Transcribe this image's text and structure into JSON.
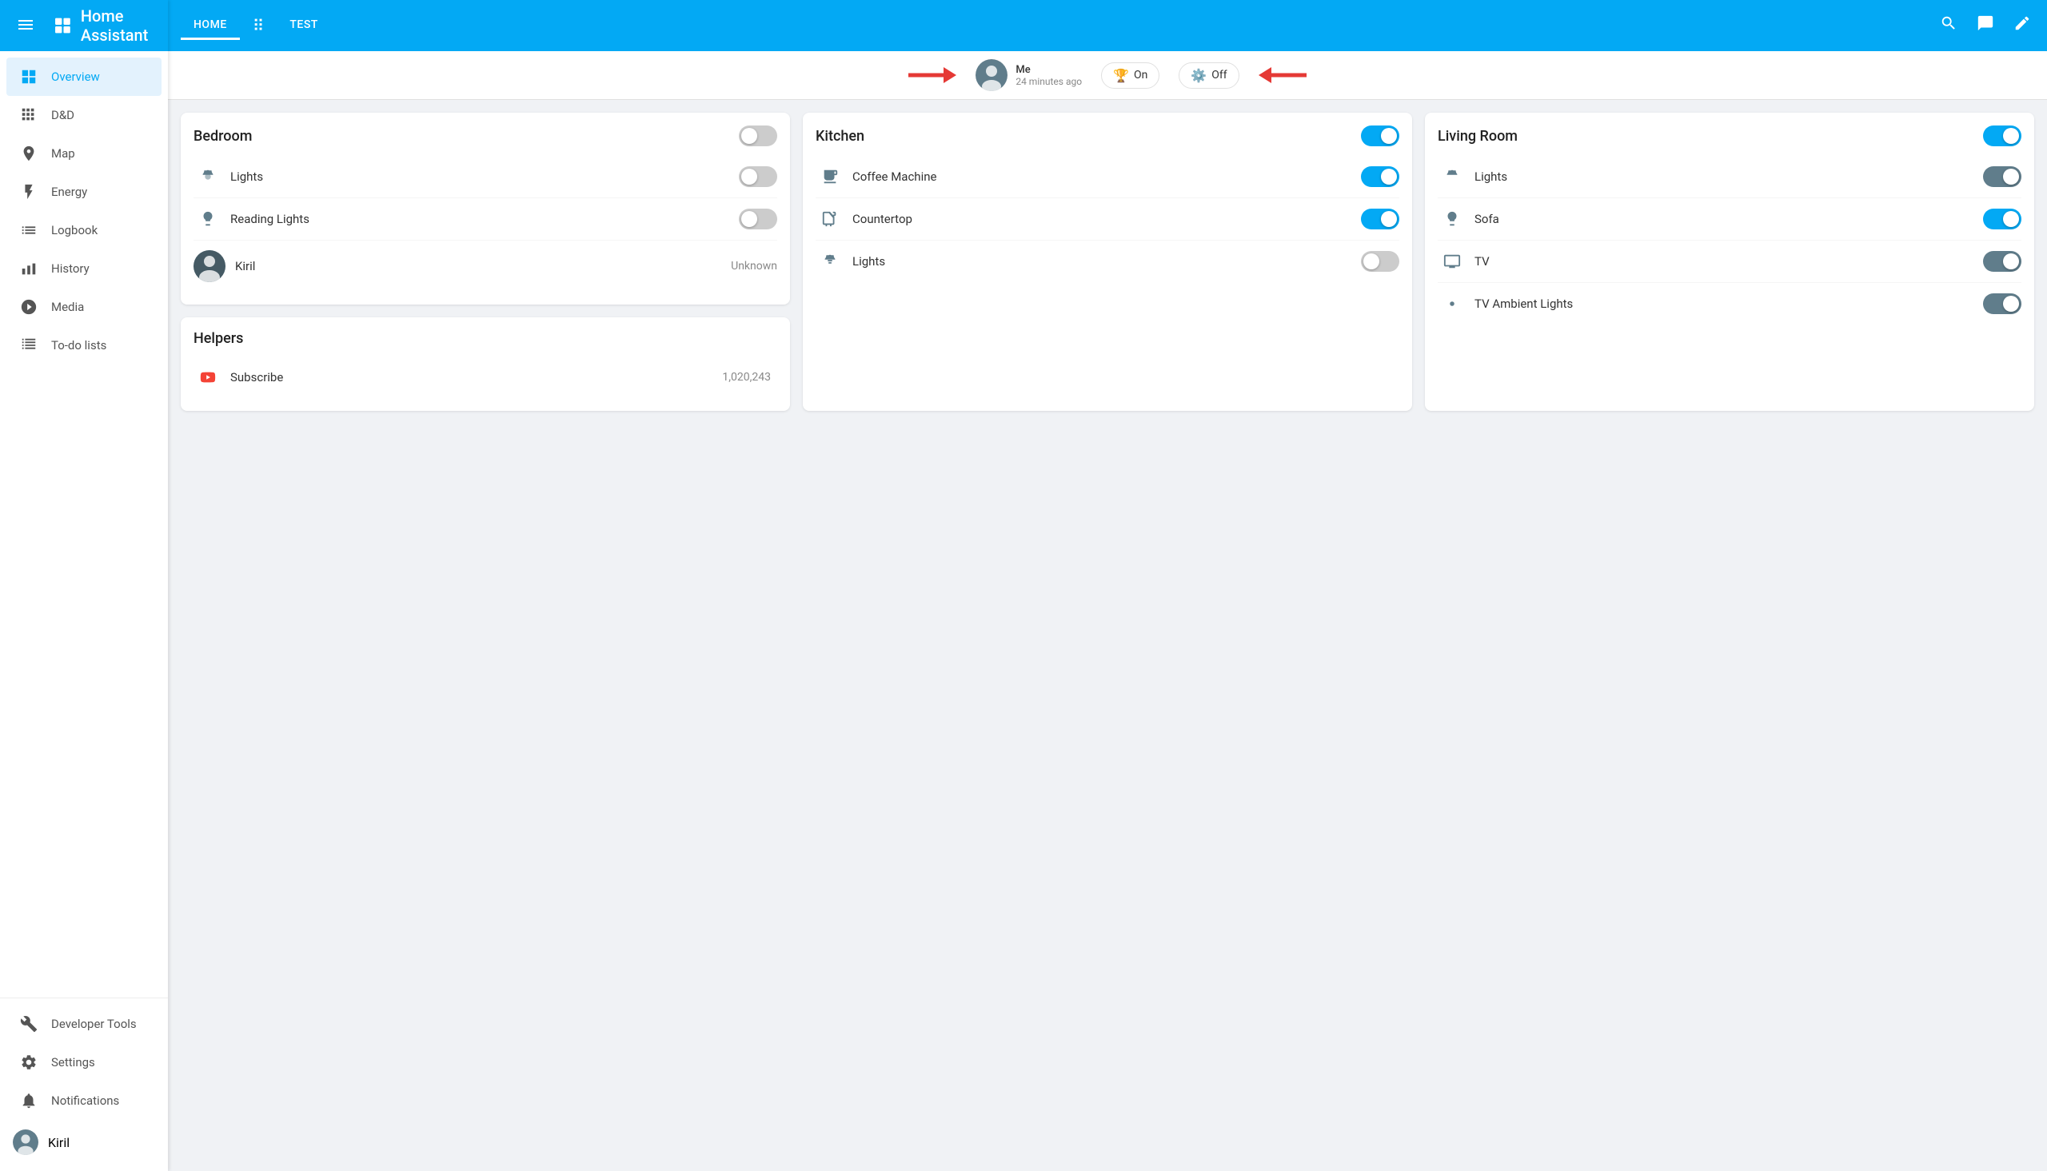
{
  "app": {
    "title": "Home Assistant",
    "logo_squares": true
  },
  "topbar": {
    "tabs": [
      {
        "label": "HOME",
        "active": true
      },
      {
        "label": "TEST",
        "active": false
      }
    ]
  },
  "notification_bar": {
    "user_name": "Me",
    "time_ago": "24 minutes ago",
    "on_label": "On",
    "off_label": "Off"
  },
  "sidebar": {
    "items": [
      {
        "label": "Overview",
        "icon": "grid",
        "active": true
      },
      {
        "label": "D&D",
        "icon": "grid-small"
      },
      {
        "label": "Map",
        "icon": "person"
      },
      {
        "label": "Energy",
        "icon": "bolt"
      },
      {
        "label": "Logbook",
        "icon": "list"
      },
      {
        "label": "History",
        "icon": "bar-chart"
      },
      {
        "label": "Media",
        "icon": "play-circle"
      },
      {
        "label": "To-do lists",
        "icon": "check-list"
      }
    ],
    "bottom": [
      {
        "label": "Developer Tools",
        "icon": "wrench"
      },
      {
        "label": "Settings",
        "icon": "gear"
      },
      {
        "label": "Notifications",
        "icon": "bell"
      }
    ],
    "user": {
      "name": "Kiril"
    }
  },
  "bedroom": {
    "title": "Bedroom",
    "toggle_state": "off",
    "items": [
      {
        "label": "Lights",
        "icon": "hub",
        "state": "off"
      },
      {
        "label": "Reading Lights",
        "icon": "lamp",
        "state": "off"
      }
    ],
    "person": {
      "name": "Kiril",
      "status": "Unknown"
    }
  },
  "helpers": {
    "title": "Helpers",
    "items": [
      {
        "label": "Subscribe",
        "icon": "youtube",
        "value": "1,020,243"
      }
    ]
  },
  "kitchen": {
    "title": "Kitchen",
    "toggle_state": "on",
    "items": [
      {
        "label": "Coffee Machine",
        "icon": "coffee",
        "state": "on"
      },
      {
        "label": "Countertop",
        "icon": "outlet",
        "state": "on"
      },
      {
        "label": "Lights",
        "icon": "hub",
        "state": "off"
      }
    ]
  },
  "living_room": {
    "title": "Living Room",
    "toggle_state": "on",
    "items": [
      {
        "label": "Lights",
        "icon": "hub",
        "state": "off"
      },
      {
        "label": "Sofa",
        "icon": "lamp2",
        "state": "on"
      },
      {
        "label": "TV",
        "icon": "tv",
        "state": "off"
      },
      {
        "label": "TV Ambient Lights",
        "icon": "ambient",
        "state": "off"
      }
    ]
  }
}
